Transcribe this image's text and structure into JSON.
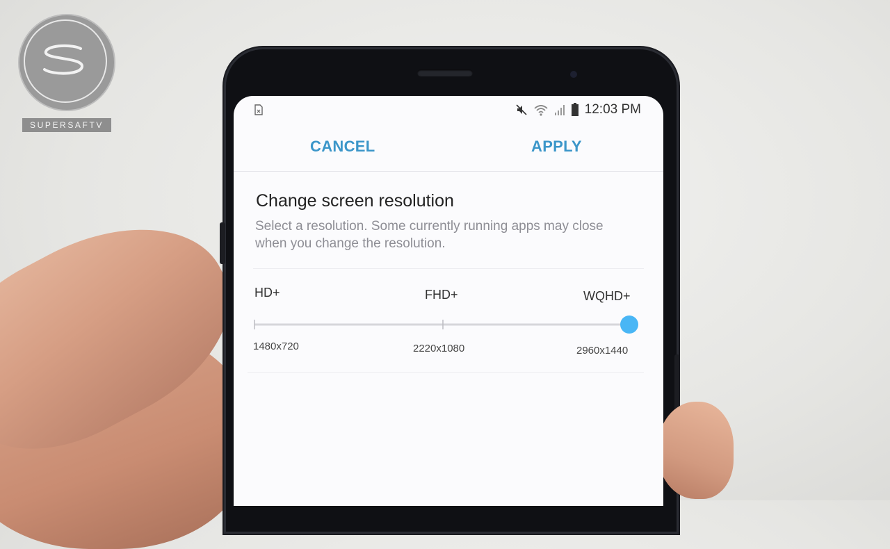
{
  "watermark": {
    "text": "SUPERSAFTV"
  },
  "status_bar": {
    "time": "12:03 PM"
  },
  "actions": {
    "cancel": "CANCEL",
    "apply": "APPLY"
  },
  "dialog": {
    "title": "Change screen resolution",
    "description": "Select a resolution. Some currently running apps may close when you change the resolution."
  },
  "resolution_slider": {
    "options": [
      {
        "label": "HD+",
        "size": "1480x720"
      },
      {
        "label": "FHD+",
        "size": "2220x1080"
      },
      {
        "label": "WQHD+",
        "size": "2960x1440"
      }
    ],
    "selected_index": 2
  },
  "colors": {
    "accent": "#3b96c9",
    "slider_thumb": "#49b6f5",
    "track": "#d6d6da"
  },
  "icons": [
    "sim-card-icon",
    "mute-icon",
    "wifi-icon",
    "signal-icon",
    "battery-icon",
    "logo-s-icon"
  ]
}
